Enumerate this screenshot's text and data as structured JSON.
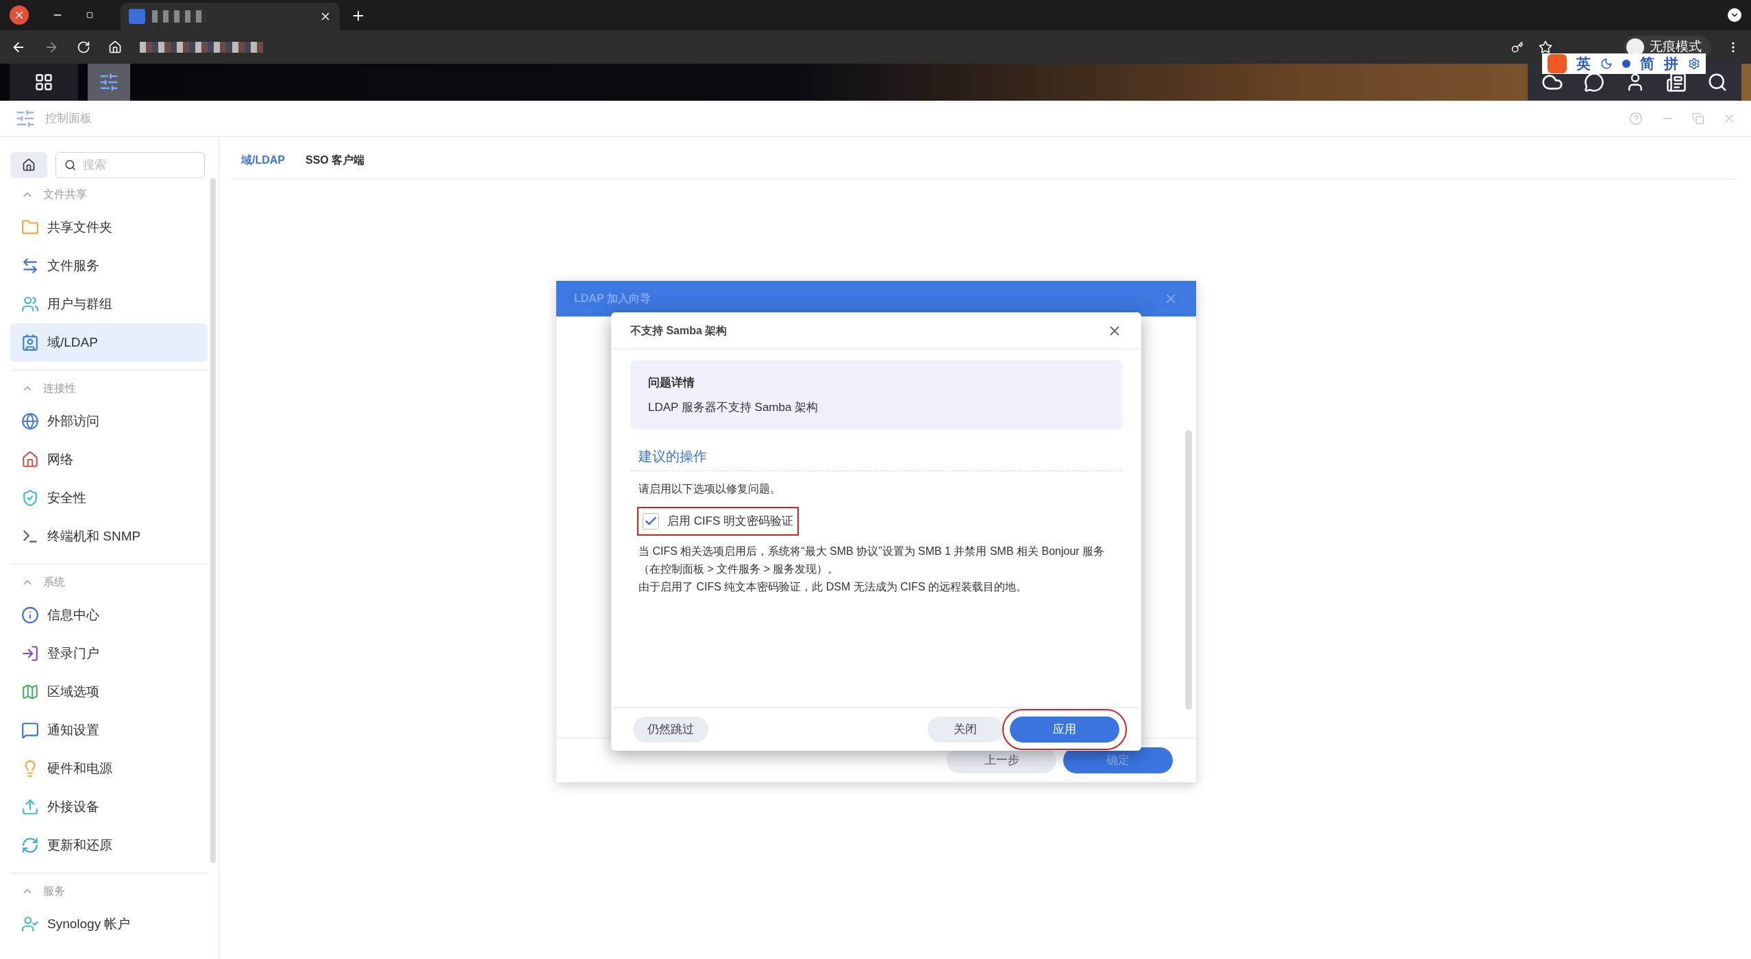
{
  "browser": {
    "profile_label": "无痕模式"
  },
  "ime_toolbar": {
    "items": [
      "英",
      "简",
      "拼"
    ]
  },
  "window": {
    "title": "控制面板"
  },
  "sidebar": {
    "search": {
      "placeholder": "搜索"
    },
    "groups": [
      {
        "title": "文件共享",
        "expanded": true,
        "items": [
          {
            "label": "共享文件夹",
            "selected": false
          },
          {
            "label": "文件服务",
            "selected": false
          },
          {
            "label": "用户与群组",
            "selected": false
          },
          {
            "label": "域/LDAP",
            "selected": true
          }
        ]
      },
      {
        "title": "连接性",
        "expanded": true,
        "items": [
          {
            "label": "外部访问",
            "selected": false
          },
          {
            "label": "网络",
            "selected": false
          },
          {
            "label": "安全性",
            "selected": false
          },
          {
            "label": "终端机和 SNMP",
            "selected": false
          }
        ]
      },
      {
        "title": "系统",
        "expanded": true,
        "items": [
          {
            "label": "信息中心",
            "selected": false
          },
          {
            "label": "登录门户",
            "selected": false
          },
          {
            "label": "区域选项",
            "selected": false
          },
          {
            "label": "通知设置",
            "selected": false
          },
          {
            "label": "硬件和电源",
            "selected": false
          },
          {
            "label": "外接设备",
            "selected": false
          },
          {
            "label": "更新和还原",
            "selected": false
          }
        ]
      },
      {
        "title": "服务",
        "expanded": true,
        "items": [
          {
            "label": "Synology 帐户",
            "selected": false
          }
        ]
      }
    ]
  },
  "tabs": [
    {
      "label": "域/LDAP",
      "selected": true
    },
    {
      "label": "SSO 客户端",
      "selected": false
    }
  ],
  "wizard": {
    "title": "LDAP 加入向导",
    "buttons": [
      {
        "label": "上一步",
        "kind": "secondary"
      },
      {
        "label": "确定",
        "kind": "primary"
      }
    ]
  },
  "dialog": {
    "title": "不支持 Samba 架构",
    "details": {
      "heading": "问题详情",
      "text": "LDAP 服务器不支持 Samba 架构"
    },
    "section_title": "建议的操作",
    "instruction": "请启用以下选项以修复问题。",
    "option": {
      "label": "启用 CIFS 明文密码验证",
      "checked": true,
      "highlighted": true
    },
    "notes": [
      "当 CIFS 相关选项启用后，系统将“最大 SMB 协议”设置为 SMB 1 并禁用 SMB 相关 Bonjour 服务（在控制面板 > 文件服务 > 服务发现）。",
      "由于启用了 CIFS 纯文本密码验证，此 DSM 无法成为 CIFS 的远程装载目的地。"
    ],
    "buttons": [
      {
        "label": "仍然跳过",
        "kind": "secondary",
        "highlighted": false
      },
      {
        "label": "关闭",
        "kind": "secondary",
        "highlighted": false
      },
      {
        "label": "应用",
        "kind": "primary",
        "highlighted": true
      }
    ]
  }
}
